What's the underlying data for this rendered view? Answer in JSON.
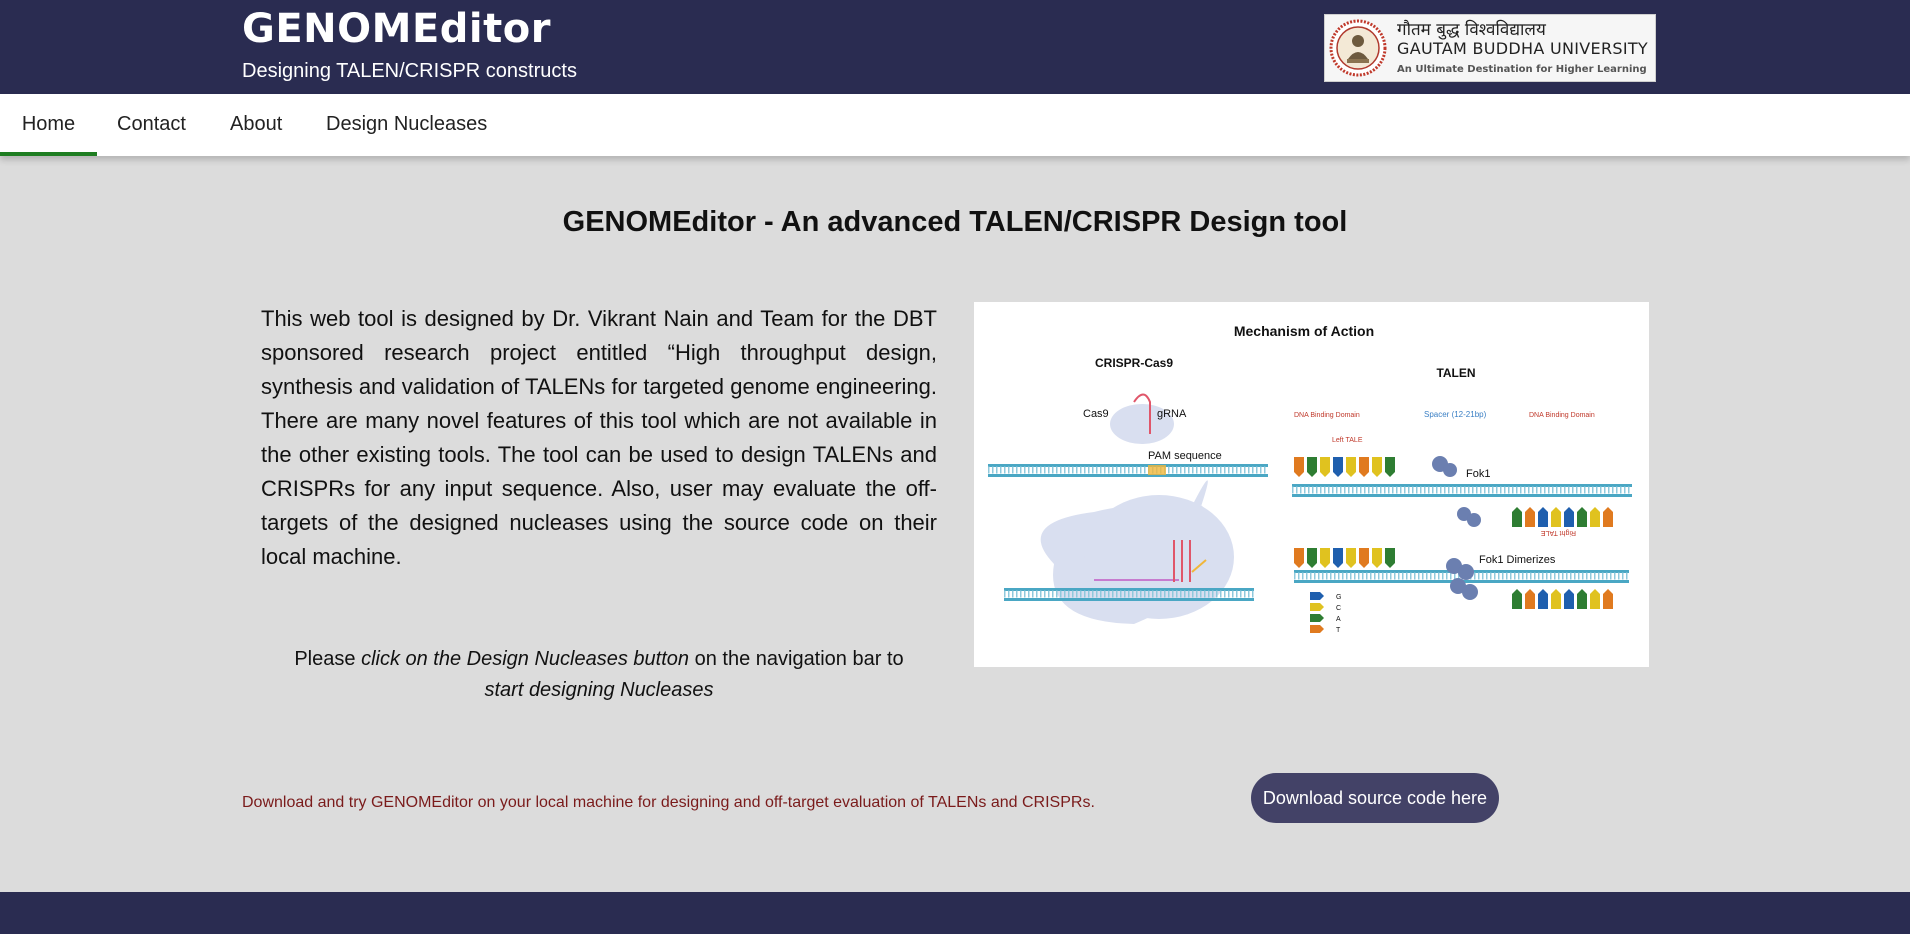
{
  "header": {
    "title": "GENOMEditor",
    "subtitle": "Designing TALEN/CRISPR constructs",
    "university": {
      "hindi_name": "गौतम बुद्ध विश्वविद्यालय",
      "name": "GAUTAM BUDDHA UNIVERSITY",
      "tagline": "An Ultimate Destination for Higher Learning"
    }
  },
  "nav": {
    "items": [
      {
        "label": "Home",
        "active": true
      },
      {
        "label": "Contact",
        "active": false
      },
      {
        "label": "About",
        "active": false
      },
      {
        "label": "Design Nucleases",
        "active": false
      }
    ]
  },
  "main": {
    "title": "GENOMEditor - An advanced TALEN/CRISPR Design tool",
    "intro": "This web tool is designed by Dr. Vikrant Nain and Team for the DBT sponsored research project entitled “High throughput design, synthesis and validation of TALENs for targeted genome engineering. There are many novel features of this tool which are not available in the other existing tools. The tool can be used to design TALENs and CRISPRs for any input sequence. Also, user may evaluate the off-targets of the designed nucleases using the source code on their local machine.",
    "instruction": {
      "part1": "Please ",
      "part2": "click on the Design Nucleases button",
      "part3": " on the navigation bar to ",
      "part4": "start designing Nucleases"
    }
  },
  "figure": {
    "title": "Mechanism of Action",
    "crispr_label": "CRISPR-Cas9",
    "talen_label": "TALEN",
    "cas9": "Cas9",
    "grna": "gRNA",
    "pam": "PAM sequence",
    "dbd_left": "DNA Binding Domain",
    "spacer": "Spacer (12-21bp)",
    "dbd_right": "DNA Binding Domain",
    "left_tale": "Left TALE",
    "right_tale": "Right TALE",
    "fok1": "Fok1",
    "fok1_dimer": "Fok1 Dimerizes",
    "legend_g": "G",
    "legend_c": "C",
    "legend_a": "A",
    "legend_t": "T"
  },
  "download": {
    "text": "Download and try GENOMEditor on your local machine for designing and off-target evaluation of TALENs and CRISPRs.",
    "button_label": "Download source code here"
  },
  "colors": {
    "header_bg": "#2a2c51",
    "active_tab": "#1e7d21",
    "button_bg": "#434267",
    "download_text": "#7a1b1b"
  }
}
